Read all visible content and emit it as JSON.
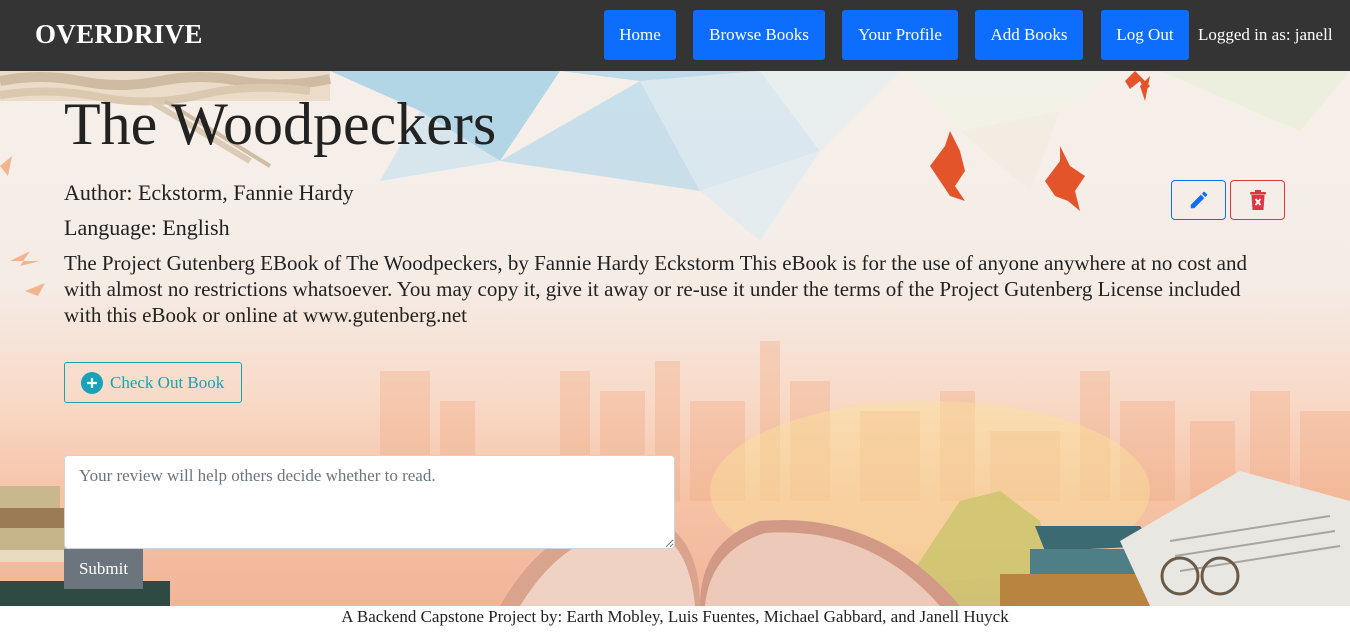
{
  "nav": {
    "brand": "OVERDRIVE",
    "items": [
      {
        "label": "Home"
      },
      {
        "label": "Browse Books"
      },
      {
        "label": "Your Profile"
      },
      {
        "label": "Add Books"
      },
      {
        "label": "Log Out"
      }
    ],
    "logged_in": "Logged in as: janell"
  },
  "book": {
    "title": "The Woodpeckers",
    "author": "Author: Eckstorm, Fannie Hardy",
    "language": "Language: English",
    "description": "The Project Gutenberg EBook of The Woodpeckers, by Fannie Hardy Eckstorm This eBook is for the use of anyone anywhere at no cost and with almost no restrictions whatsoever. You may copy it, give it away or re-use it under the terms of the Project Gutenberg License included with this eBook or online at www.gutenberg.net"
  },
  "actions": {
    "edit_icon": "pencil-icon",
    "delete_icon": "trash-x-icon",
    "checkout_label": "Check Out Book",
    "checkout_icon": "plus-circle-icon"
  },
  "review": {
    "placeholder": "Your review will help others decide whether to read.",
    "submit_label": "Submit"
  },
  "footer": {
    "credit": "A Backend Capstone Project by: Earth Mobley, Luis Fuentes, Michael Gabbard, and Janell Huyck"
  },
  "colors": {
    "navbar": "#343434",
    "primary": "#0d6efd",
    "danger": "#dc3545",
    "info": "#17a2b8",
    "secondary": "#6c757d"
  }
}
